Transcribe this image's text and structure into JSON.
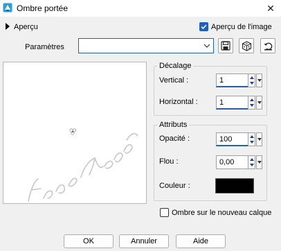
{
  "window": {
    "title": "Ombre portée",
    "close_glyph": "✕"
  },
  "preview_toggle": {
    "label": "Aperçu",
    "image_preview_label": "Aperçu de l'image",
    "image_preview_checked": true
  },
  "presets": {
    "label": "Paramètres",
    "value": ""
  },
  "offset": {
    "title": "Décalage",
    "vertical_label": "Vertical :",
    "vertical_value": "1",
    "horizontal_label": "Horizontal :",
    "horizontal_value": "1"
  },
  "attributes": {
    "title": "Attributs",
    "opacity_label": "Opacité :",
    "opacity_value": "100",
    "blur_label": "Flou :",
    "blur_value": "0,00",
    "color_label": "Couleur :",
    "color_value": "#000000"
  },
  "new_layer": {
    "label": "Ombre sur le nouveau calque",
    "checked": false
  },
  "buttons": {
    "ok": "OK",
    "cancel": "Annuler",
    "help": "Aide"
  },
  "colors": {
    "accent": "#1f5fbf",
    "background": "#f0f0f0"
  },
  "icons": {
    "app": "drop-shadow-icon",
    "save": "save-icon",
    "randomize": "dice-icon",
    "reset": "reset-icon"
  }
}
